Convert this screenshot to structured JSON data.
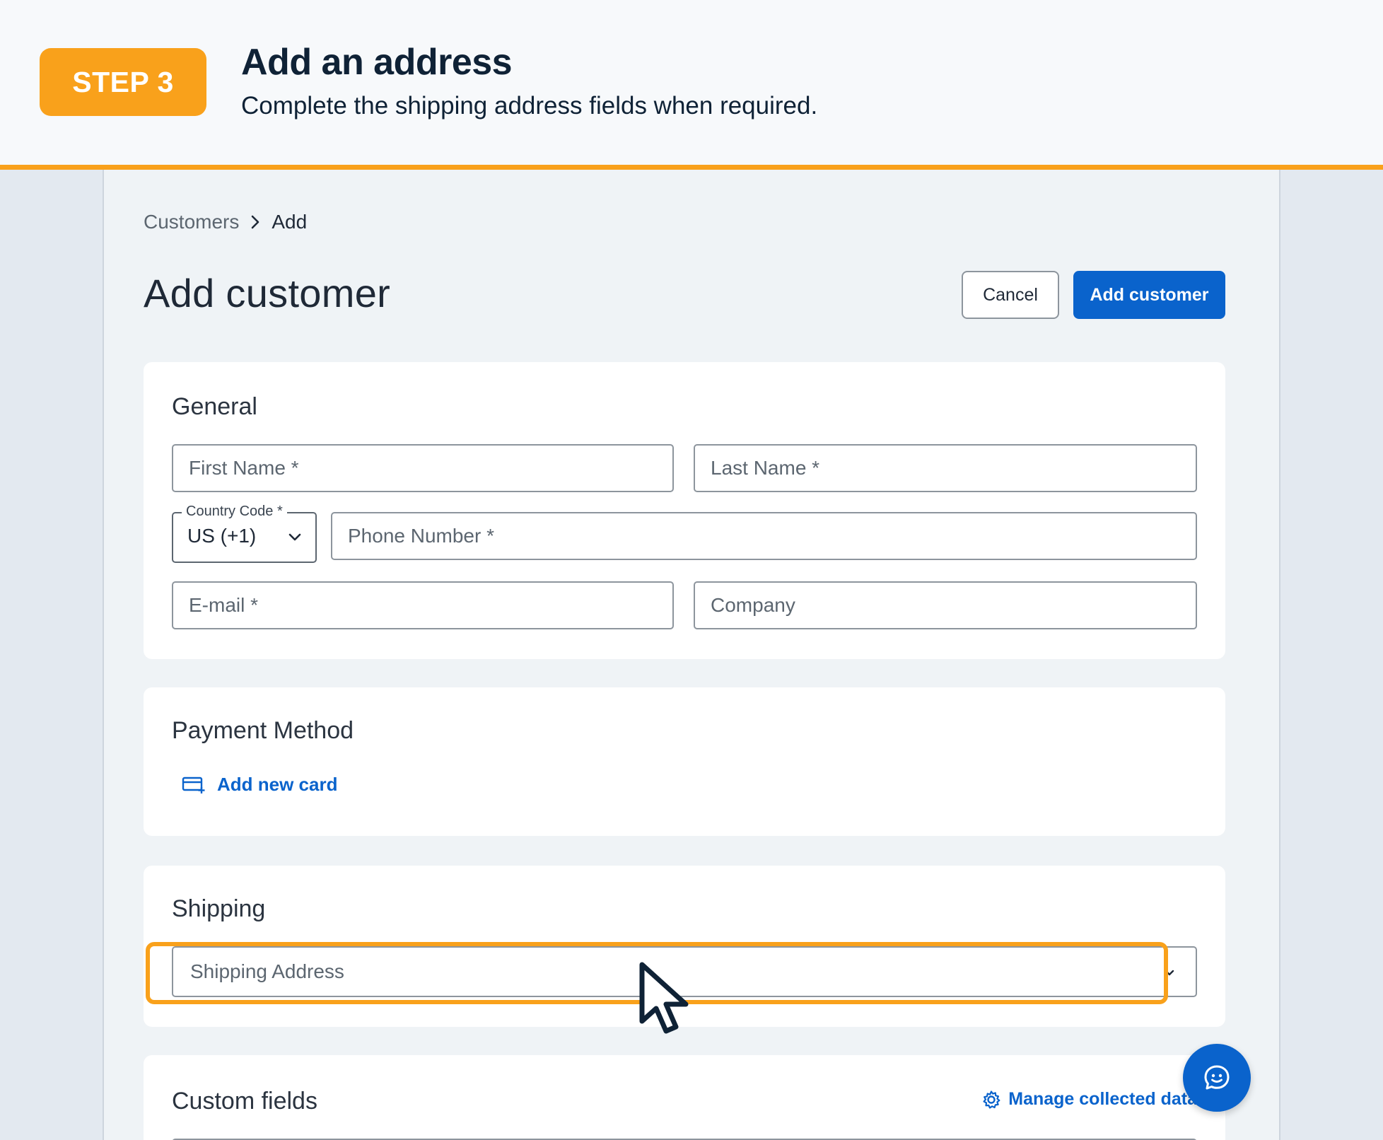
{
  "banner": {
    "step": "STEP 3",
    "title": "Add an address",
    "subtitle": "Complete the shipping address fields when required."
  },
  "breadcrumb": {
    "parent": "Customers",
    "current": "Add"
  },
  "page": {
    "title": "Add customer",
    "cancel_label": "Cancel",
    "add_label": "Add customer"
  },
  "general": {
    "title": "General",
    "first_name_placeholder": "First Name *",
    "last_name_placeholder": "Last Name *",
    "country_code_label": "Country Code *",
    "country_code_value": "US (+1)",
    "phone_placeholder": "Phone Number *",
    "email_placeholder": "E-mail *",
    "company_placeholder": "Company"
  },
  "payment": {
    "title": "Payment Method",
    "add_card_label": "Add new card"
  },
  "shipping": {
    "title": "Shipping",
    "address_placeholder": "Shipping Address"
  },
  "custom_fields": {
    "title": "Custom fields",
    "manage_label": "Manage collected data"
  },
  "colors": {
    "accent": "#f9a11b",
    "primary": "#0a63cc"
  }
}
